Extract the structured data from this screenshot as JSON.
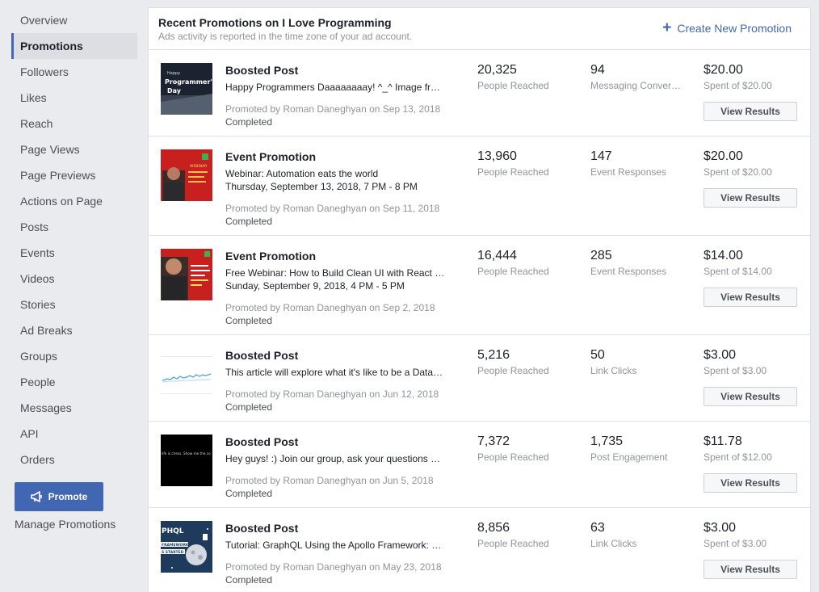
{
  "sidebar": {
    "items": [
      {
        "label": "Overview"
      },
      {
        "label": "Promotions",
        "active": true
      },
      {
        "label": "Followers"
      },
      {
        "label": "Likes"
      },
      {
        "label": "Reach"
      },
      {
        "label": "Page Views"
      },
      {
        "label": "Page Previews"
      },
      {
        "label": "Actions on Page"
      },
      {
        "label": "Posts"
      },
      {
        "label": "Events"
      },
      {
        "label": "Videos"
      },
      {
        "label": "Stories"
      },
      {
        "label": "Ad Breaks"
      },
      {
        "label": "Groups"
      },
      {
        "label": "People"
      },
      {
        "label": "Messages"
      },
      {
        "label": "API"
      },
      {
        "label": "Orders"
      }
    ],
    "promote_label": "Promote",
    "manage_label": "Manage Promotions"
  },
  "panel": {
    "title": "Recent Promotions on I Love Programming",
    "subtitle": "Ads activity is reported in the time zone of your ad account.",
    "create_label": "Create New Promotion",
    "view_label": "View Results"
  },
  "promotions": [
    {
      "type": "Boosted Post",
      "line1": "Happy Programmers Daaaaaaaay! ^_^ Image from: https://example",
      "line2": "",
      "promoted": "Promoted by Roman Daneghyan on Sep 13, 2018",
      "status": "Completed",
      "reach": "20,325",
      "reach_label": "People Reached",
      "result": "94",
      "result_label": "Messaging Conversations",
      "spent": "$20.00",
      "spent_label": "Spent of $20.00",
      "thumb": "programmers-day"
    },
    {
      "type": "Event Promotion",
      "line1": "Webinar: Automation eats the world",
      "line2": "Thursday, September 13, 2018, 7 PM - 8 PM",
      "promoted": "Promoted by Roman Daneghyan on Sep 11, 2018",
      "status": "Completed",
      "reach": "13,960",
      "reach_label": "People Reached",
      "result": "147",
      "result_label": "Event Responses",
      "spent": "$20.00",
      "spent_label": "Spent of $20.00",
      "thumb": "webinar-red-1"
    },
    {
      "type": "Event Promotion",
      "line1": "Free Webinar: How to Build Clean UI with React and Redux",
      "line2": "Sunday, September 9, 2018, 4 PM - 5 PM",
      "promoted": "Promoted by Roman Daneghyan on Sep 2, 2018",
      "status": "Completed",
      "reach": "16,444",
      "reach_label": "People Reached",
      "result": "285",
      "result_label": "Event Responses",
      "spent": "$14.00",
      "spent_label": "Spent of $14.00",
      "thumb": "webinar-red-2"
    },
    {
      "type": "Boosted Post",
      "line1": "This article will explore what it's like to be a Data Scientist",
      "line2": "",
      "promoted": "Promoted by Roman Daneghyan on Jun 12, 2018",
      "status": "Completed",
      "reach": "5,216",
      "reach_label": "People Reached",
      "result": "50",
      "result_label": "Link Clicks",
      "spent": "$3.00",
      "spent_label": "Spent of $3.00",
      "thumb": "line-chart"
    },
    {
      "type": "Boosted Post",
      "line1": "Hey guys! :) Join our group, ask your questions and share",
      "line2": "",
      "promoted": "Promoted by Roman Daneghyan on Jun 5, 2018",
      "status": "Completed",
      "reach": "7,372",
      "reach_label": "People Reached",
      "result": "1,735",
      "result_label": "Post Engagement",
      "spent": "$11.78",
      "spent_label": "Spent of $12.00",
      "thumb": "black-text"
    },
    {
      "type": "Boosted Post",
      "line1": "Tutorial: GraphQL Using the Apollo Framework: Getting Started",
      "line2": "",
      "promoted": "Promoted by Roman Daneghyan on May 23, 2018",
      "status": "Completed",
      "reach": "8,856",
      "reach_label": "People Reached",
      "result": "63",
      "result_label": "Link Clicks",
      "spent": "$3.00",
      "spent_label": "Spent of $3.00",
      "thumb": "graphql"
    }
  ],
  "thumb_text": {
    "programmers_day": [
      "Happy",
      "Programmer's",
      "Day"
    ],
    "webinar": "WEBINAR",
    "black_text": "life is chess. Show me the co",
    "graphql": [
      "PHQL",
      "FRAMEWORK",
      "S STARTED"
    ]
  }
}
